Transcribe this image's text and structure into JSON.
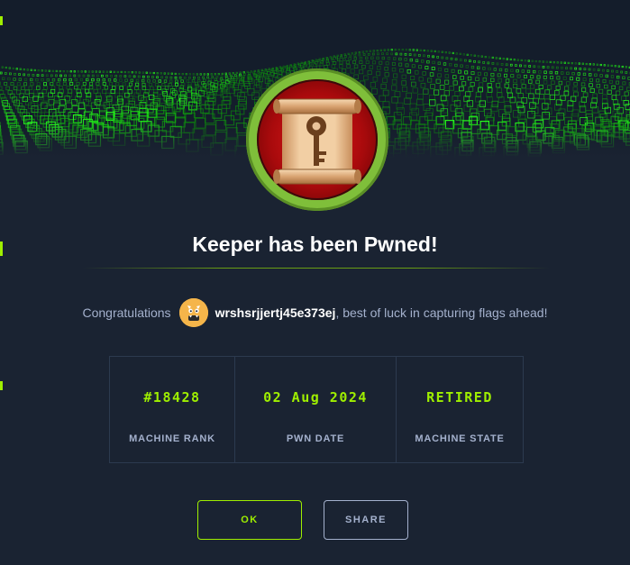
{
  "modal": {
    "title": "Keeper has been Pwned!",
    "congrats_prefix": "Congratulations",
    "username": "wrshsrjjertj45e373ej",
    "congrats_suffix": ", best of luck in capturing flags ahead!",
    "badge_icon": "key-scroll-icon",
    "avatar_icon": "monster-avatar-icon"
  },
  "stats": [
    {
      "value": "#18428",
      "label": "MACHINE RANK"
    },
    {
      "value": "02 Aug 2024",
      "label": "PWN DATE"
    },
    {
      "value": "RETIRED",
      "label": "MACHINE STATE"
    }
  ],
  "buttons": {
    "ok": "OK",
    "share": "SHARE"
  },
  "colors": {
    "accent": "#9fef00",
    "background": "#1a2332",
    "muted_text": "#a4b1cd",
    "border": "#2c3a4f",
    "badge_ring": "#7fbf3a",
    "badge_core": "#c4100f",
    "avatar": "#f5b54a"
  }
}
